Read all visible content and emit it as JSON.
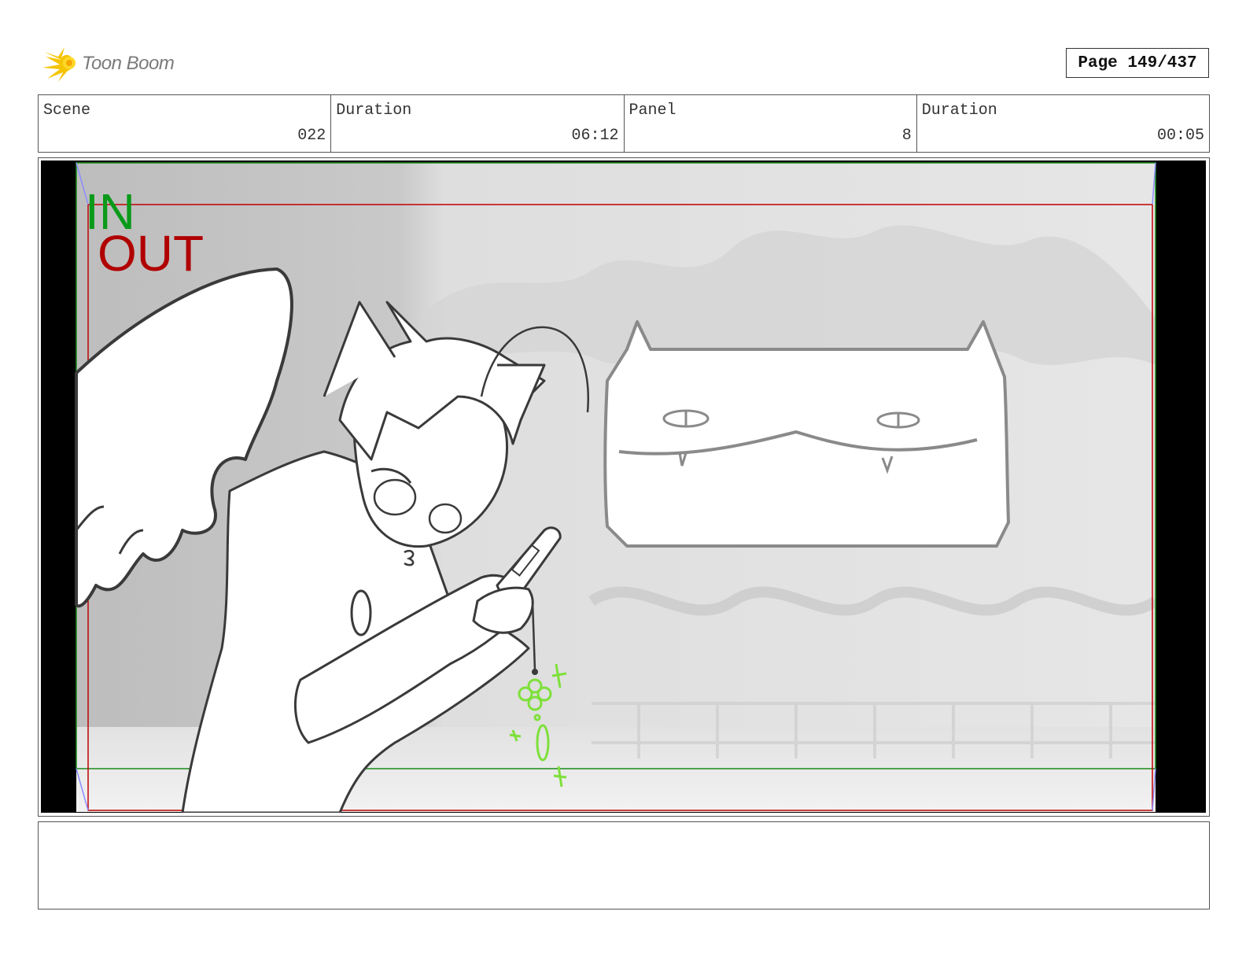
{
  "header": {
    "logo_text": "Toon Boom",
    "page_label": "Page 149/437"
  },
  "info": [
    {
      "label": "Scene",
      "value": "022"
    },
    {
      "label": "Duration",
      "value": "06:12"
    },
    {
      "label": "Panel",
      "value": "8"
    },
    {
      "label": "Duration",
      "value": "00:05"
    }
  ],
  "panel": {
    "in_label": "IN",
    "out_label": "OUT",
    "colors": {
      "in": "#0a9a1a",
      "out": "#b00000",
      "charm": "#7ee03a",
      "sketch": "#3a3a3a"
    }
  },
  "notes": ""
}
